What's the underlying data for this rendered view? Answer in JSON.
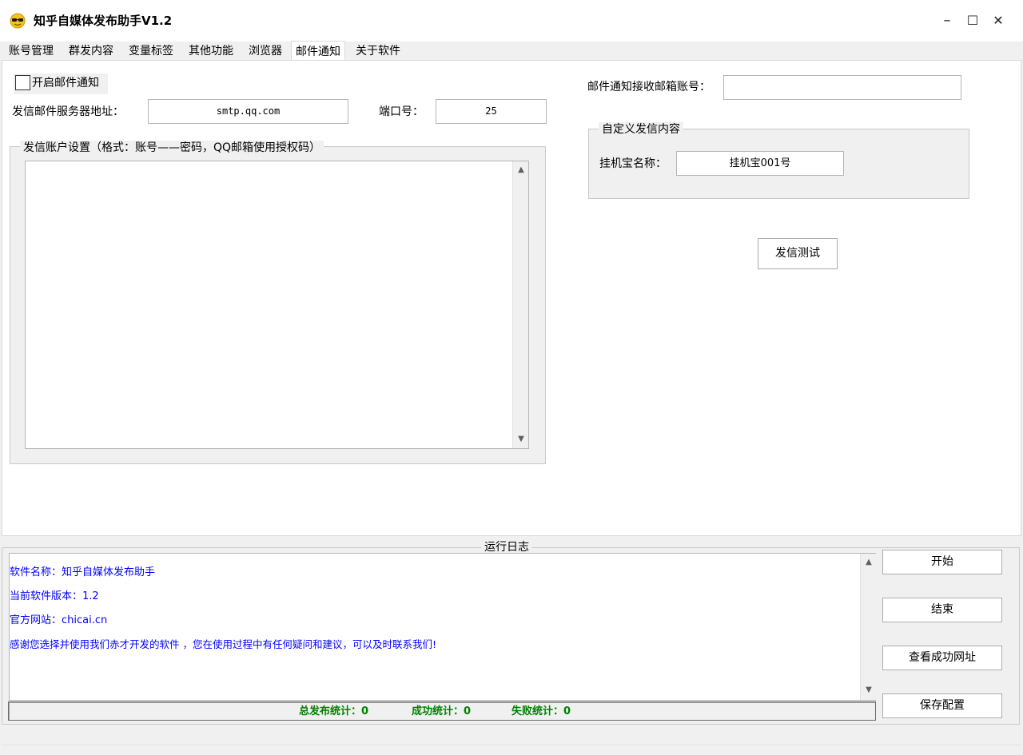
{
  "window": {
    "title": "知乎自媒体发布助手V1.2",
    "icon": "sunglasses-face-icon",
    "minimize": "–",
    "maximize": "☐",
    "close": "✕"
  },
  "tabs": [
    {
      "label": "账号管理",
      "active": false
    },
    {
      "label": "群发内容",
      "active": false
    },
    {
      "label": "变量标签",
      "active": false
    },
    {
      "label": "其他功能",
      "active": false
    },
    {
      "label": "浏览器",
      "active": false
    },
    {
      "label": "邮件通知",
      "active": true
    },
    {
      "label": "关于软件",
      "active": false
    }
  ],
  "email": {
    "enable_label": "开启邮件通知",
    "enabled": false,
    "server_label": "发信邮件服务器地址：",
    "server_value": "smtp.qq.com",
    "port_label": "端口号：",
    "port_value": "25",
    "account_group_label": "发信账户设置（格式：账号——密码，QQ邮箱使用授权码）",
    "account_text": "",
    "receiver_label": "邮件通知接收邮箱账号：",
    "receiver_value": "",
    "custom_group_label": "自定义发信内容",
    "machine_name_label": "挂机宝名称：",
    "machine_name_value": "挂机宝001号",
    "test_button": "发信测试"
  },
  "log": {
    "title": "运行日志",
    "lines": [
      "软件名称：知乎自媒体发布助手",
      "当前软件版本：1.2",
      "官方网站：chicai.cn",
      "感谢您选择并使用我们赤才开发的软件 ，您在使用过程中有任何疑问和建议，可以及时联系我们!"
    ],
    "line_color": "#0000ff"
  },
  "stats": {
    "total": "总发布统计：0",
    "success": "成功统计：0",
    "fail": "失败统计：0",
    "color": "#008000"
  },
  "actions": {
    "start": "开始",
    "stop": "结束",
    "view_success": "查看成功网址",
    "save_config": "保存配置"
  }
}
